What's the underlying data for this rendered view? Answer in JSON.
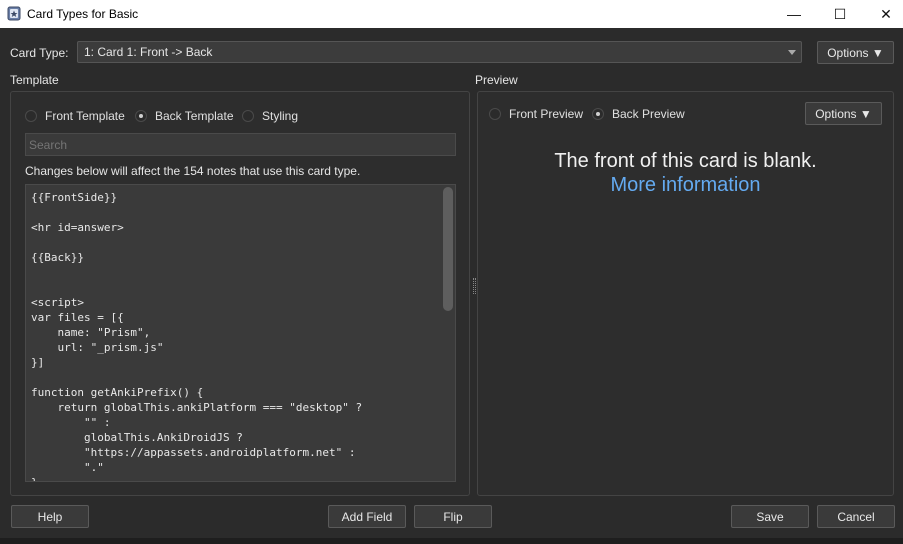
{
  "window": {
    "title": "Card Types for Basic",
    "minimize_glyph": "—",
    "maximize_glyph": "☐",
    "close_glyph": "✕"
  },
  "card_type": {
    "label": "Card Type:",
    "selected": "1: Card 1: Front -> Back",
    "options_button": "Options ▼"
  },
  "template": {
    "group_label": "Template",
    "radios": [
      {
        "label": "Front Template",
        "checked": false
      },
      {
        "label": "Back Template",
        "checked": true
      },
      {
        "label": "Styling",
        "checked": false
      }
    ],
    "search_placeholder": "Search",
    "notice": "Changes below will affect the 154 notes that use this card type.",
    "code": "{{FrontSide}}\n\n<hr id=answer>\n\n{{Back}}\n\n\n<script>\nvar files = [{\n    name: \"Prism\",\n    url: \"_prism.js\"\n}]\n\nfunction getAnkiPrefix() {\n    return globalThis.ankiPlatform === \"desktop\" ?\n        \"\" :\n        globalThis.AnkiDroidJS ?\n        \"https://appassets.androidplatform.net\" :\n        \".\"\n}"
  },
  "preview": {
    "group_label": "Preview",
    "radios": [
      {
        "label": "Front Preview",
        "checked": false
      },
      {
        "label": "Back Preview",
        "checked": true
      }
    ],
    "options_button": "Options ▼",
    "message": "The front of this card is blank.",
    "link": "More information"
  },
  "buttons": {
    "help": "Help",
    "add_field": "Add Field",
    "flip": "Flip",
    "save": "Save",
    "cancel": "Cancel"
  },
  "colors": {
    "background": "#2b2b2b",
    "link": "#64aaf0"
  }
}
